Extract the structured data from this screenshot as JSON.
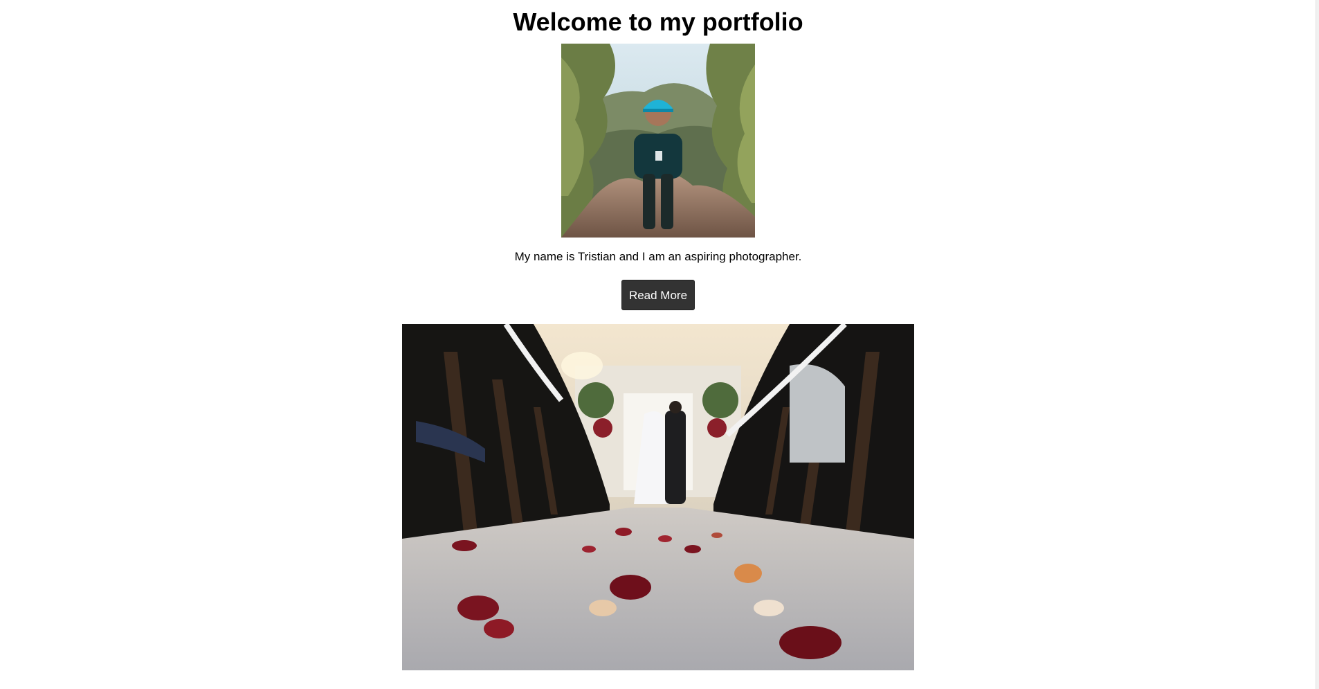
{
  "header": {
    "title": "Welcome to my portfolio"
  },
  "profile": {
    "photo_icon": "portrait-photo",
    "intro_text": "My name is Tristian and I am an aspiring photographer."
  },
  "actions": {
    "read_more_label": "Read More"
  },
  "gallery": {
    "photo_icon": "wedding-aisle-photo"
  },
  "colors": {
    "button_bg": "#333333",
    "button_text": "#ffffff",
    "page_bg": "#ffffff"
  }
}
